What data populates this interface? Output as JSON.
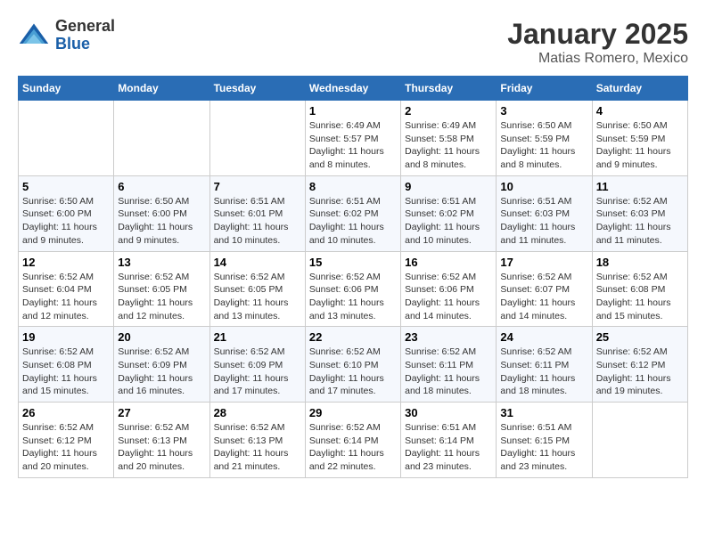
{
  "header": {
    "logo_general": "General",
    "logo_blue": "Blue",
    "title": "January 2025",
    "subtitle": "Matias Romero, Mexico"
  },
  "days_of_week": [
    "Sunday",
    "Monday",
    "Tuesday",
    "Wednesday",
    "Thursday",
    "Friday",
    "Saturday"
  ],
  "weeks": [
    [
      {
        "day": "",
        "info": ""
      },
      {
        "day": "",
        "info": ""
      },
      {
        "day": "",
        "info": ""
      },
      {
        "day": "1",
        "info": "Sunrise: 6:49 AM\nSunset: 5:57 PM\nDaylight: 11 hours and 8 minutes."
      },
      {
        "day": "2",
        "info": "Sunrise: 6:49 AM\nSunset: 5:58 PM\nDaylight: 11 hours and 8 minutes."
      },
      {
        "day": "3",
        "info": "Sunrise: 6:50 AM\nSunset: 5:59 PM\nDaylight: 11 hours and 8 minutes."
      },
      {
        "day": "4",
        "info": "Sunrise: 6:50 AM\nSunset: 5:59 PM\nDaylight: 11 hours and 9 minutes."
      }
    ],
    [
      {
        "day": "5",
        "info": "Sunrise: 6:50 AM\nSunset: 6:00 PM\nDaylight: 11 hours and 9 minutes."
      },
      {
        "day": "6",
        "info": "Sunrise: 6:50 AM\nSunset: 6:00 PM\nDaylight: 11 hours and 9 minutes."
      },
      {
        "day": "7",
        "info": "Sunrise: 6:51 AM\nSunset: 6:01 PM\nDaylight: 11 hours and 10 minutes."
      },
      {
        "day": "8",
        "info": "Sunrise: 6:51 AM\nSunset: 6:02 PM\nDaylight: 11 hours and 10 minutes."
      },
      {
        "day": "9",
        "info": "Sunrise: 6:51 AM\nSunset: 6:02 PM\nDaylight: 11 hours and 10 minutes."
      },
      {
        "day": "10",
        "info": "Sunrise: 6:51 AM\nSunset: 6:03 PM\nDaylight: 11 hours and 11 minutes."
      },
      {
        "day": "11",
        "info": "Sunrise: 6:52 AM\nSunset: 6:03 PM\nDaylight: 11 hours and 11 minutes."
      }
    ],
    [
      {
        "day": "12",
        "info": "Sunrise: 6:52 AM\nSunset: 6:04 PM\nDaylight: 11 hours and 12 minutes."
      },
      {
        "day": "13",
        "info": "Sunrise: 6:52 AM\nSunset: 6:05 PM\nDaylight: 11 hours and 12 minutes."
      },
      {
        "day": "14",
        "info": "Sunrise: 6:52 AM\nSunset: 6:05 PM\nDaylight: 11 hours and 13 minutes."
      },
      {
        "day": "15",
        "info": "Sunrise: 6:52 AM\nSunset: 6:06 PM\nDaylight: 11 hours and 13 minutes."
      },
      {
        "day": "16",
        "info": "Sunrise: 6:52 AM\nSunset: 6:06 PM\nDaylight: 11 hours and 14 minutes."
      },
      {
        "day": "17",
        "info": "Sunrise: 6:52 AM\nSunset: 6:07 PM\nDaylight: 11 hours and 14 minutes."
      },
      {
        "day": "18",
        "info": "Sunrise: 6:52 AM\nSunset: 6:08 PM\nDaylight: 11 hours and 15 minutes."
      }
    ],
    [
      {
        "day": "19",
        "info": "Sunrise: 6:52 AM\nSunset: 6:08 PM\nDaylight: 11 hours and 15 minutes."
      },
      {
        "day": "20",
        "info": "Sunrise: 6:52 AM\nSunset: 6:09 PM\nDaylight: 11 hours and 16 minutes."
      },
      {
        "day": "21",
        "info": "Sunrise: 6:52 AM\nSunset: 6:09 PM\nDaylight: 11 hours and 17 minutes."
      },
      {
        "day": "22",
        "info": "Sunrise: 6:52 AM\nSunset: 6:10 PM\nDaylight: 11 hours and 17 minutes."
      },
      {
        "day": "23",
        "info": "Sunrise: 6:52 AM\nSunset: 6:11 PM\nDaylight: 11 hours and 18 minutes."
      },
      {
        "day": "24",
        "info": "Sunrise: 6:52 AM\nSunset: 6:11 PM\nDaylight: 11 hours and 18 minutes."
      },
      {
        "day": "25",
        "info": "Sunrise: 6:52 AM\nSunset: 6:12 PM\nDaylight: 11 hours and 19 minutes."
      }
    ],
    [
      {
        "day": "26",
        "info": "Sunrise: 6:52 AM\nSunset: 6:12 PM\nDaylight: 11 hours and 20 minutes."
      },
      {
        "day": "27",
        "info": "Sunrise: 6:52 AM\nSunset: 6:13 PM\nDaylight: 11 hours and 20 minutes."
      },
      {
        "day": "28",
        "info": "Sunrise: 6:52 AM\nSunset: 6:13 PM\nDaylight: 11 hours and 21 minutes."
      },
      {
        "day": "29",
        "info": "Sunrise: 6:52 AM\nSunset: 6:14 PM\nDaylight: 11 hours and 22 minutes."
      },
      {
        "day": "30",
        "info": "Sunrise: 6:51 AM\nSunset: 6:14 PM\nDaylight: 11 hours and 23 minutes."
      },
      {
        "day": "31",
        "info": "Sunrise: 6:51 AM\nSunset: 6:15 PM\nDaylight: 11 hours and 23 minutes."
      },
      {
        "day": "",
        "info": ""
      }
    ]
  ]
}
